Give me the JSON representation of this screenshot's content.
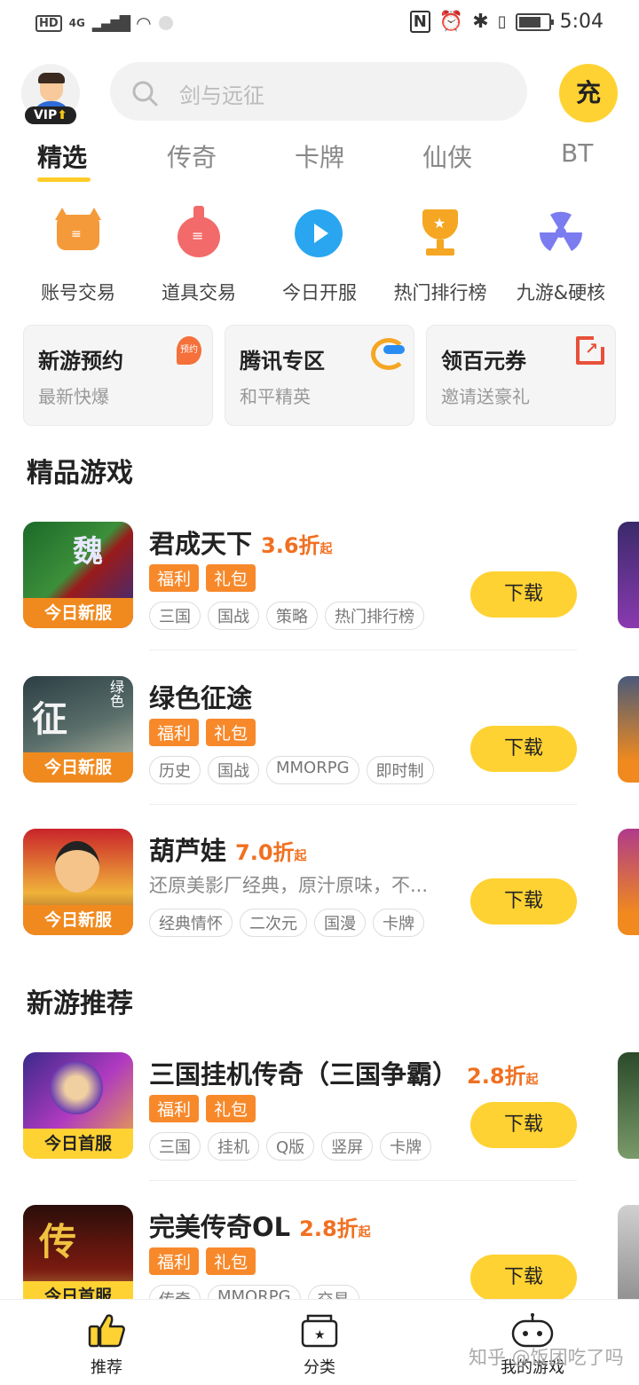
{
  "status_bar": {
    "left": {
      "hd": "HD",
      "net": "4G"
    },
    "time": "5:04"
  },
  "header": {
    "vip_label": "VIP",
    "search_placeholder": "剑与远征",
    "charge_label": "充"
  },
  "tabs": [
    {
      "label": "精选",
      "active": true
    },
    {
      "label": "传奇"
    },
    {
      "label": "卡牌"
    },
    {
      "label": "仙侠"
    },
    {
      "label": "BT"
    }
  ],
  "quick_links": [
    {
      "label": "账号交易",
      "icon": "devil-bag-icon"
    },
    {
      "label": "道具交易",
      "icon": "money-bag-icon"
    },
    {
      "label": "今日开服",
      "icon": "play-icon"
    },
    {
      "label": "热门排行榜",
      "icon": "trophy-icon"
    },
    {
      "label": "九游&硬核",
      "icon": "radiation-icon"
    }
  ],
  "promo_cards": [
    {
      "title": "新游预约",
      "subtitle": "最新快爆",
      "icon_label": "预约"
    },
    {
      "title": "腾讯专区",
      "subtitle": "和平精英"
    },
    {
      "title": "领百元券",
      "subtitle": "邀请送豪礼"
    }
  ],
  "section_featured": "精品游戏",
  "section_new": "新游推荐",
  "featured_games": [
    {
      "name": "君成天下",
      "discount": "3.6折",
      "discount_suffix": "起",
      "band": "今日新服",
      "badges": [
        "福利",
        "礼包"
      ],
      "tags": [
        "三国",
        "国战",
        "策略",
        "热门排行榜"
      ],
      "download": "下载"
    },
    {
      "name": "绿色征途",
      "discount": "",
      "discount_suffix": "",
      "band": "今日新服",
      "badges": [
        "福利",
        "礼包"
      ],
      "tags": [
        "历史",
        "国战",
        "MMORPG",
        "即时制"
      ],
      "download": "下载"
    },
    {
      "name": "葫芦娃",
      "discount": "7.0折",
      "discount_suffix": "起",
      "band": "今日新服",
      "desc": "还原美影厂经典，原汁原味，不...",
      "tags": [
        "经典情怀",
        "二次元",
        "国漫",
        "卡牌"
      ],
      "download": "下载"
    }
  ],
  "new_games": [
    {
      "name": "三国挂机传奇（三国争霸）",
      "discount": "2.8折",
      "discount_suffix": "起",
      "band": "今日首服",
      "badges": [
        "福利",
        "礼包"
      ],
      "tags": [
        "三国",
        "挂机",
        "Q版",
        "竖屏",
        "卡牌"
      ],
      "download": "下载"
    },
    {
      "name": "完美传奇OL",
      "discount": "2.8折",
      "discount_suffix": "起",
      "band": "今日首服",
      "badges": [
        "福利",
        "礼包"
      ],
      "tags": [
        "传奇",
        "MMORPG",
        "交易"
      ],
      "download": "下载"
    }
  ],
  "bottom_nav": [
    {
      "label": "推荐",
      "icon": "thumbs-up-icon"
    },
    {
      "label": "分类",
      "icon": "category-box-icon"
    },
    {
      "label": "我的游戏",
      "icon": "gamepad-icon"
    }
  ],
  "watermark": "知乎 @饭团吃了吗",
  "colors": {
    "accent": "#ffd233",
    "discount": "#f07021",
    "badge": "#f7892b",
    "band": "#f08a1e"
  }
}
